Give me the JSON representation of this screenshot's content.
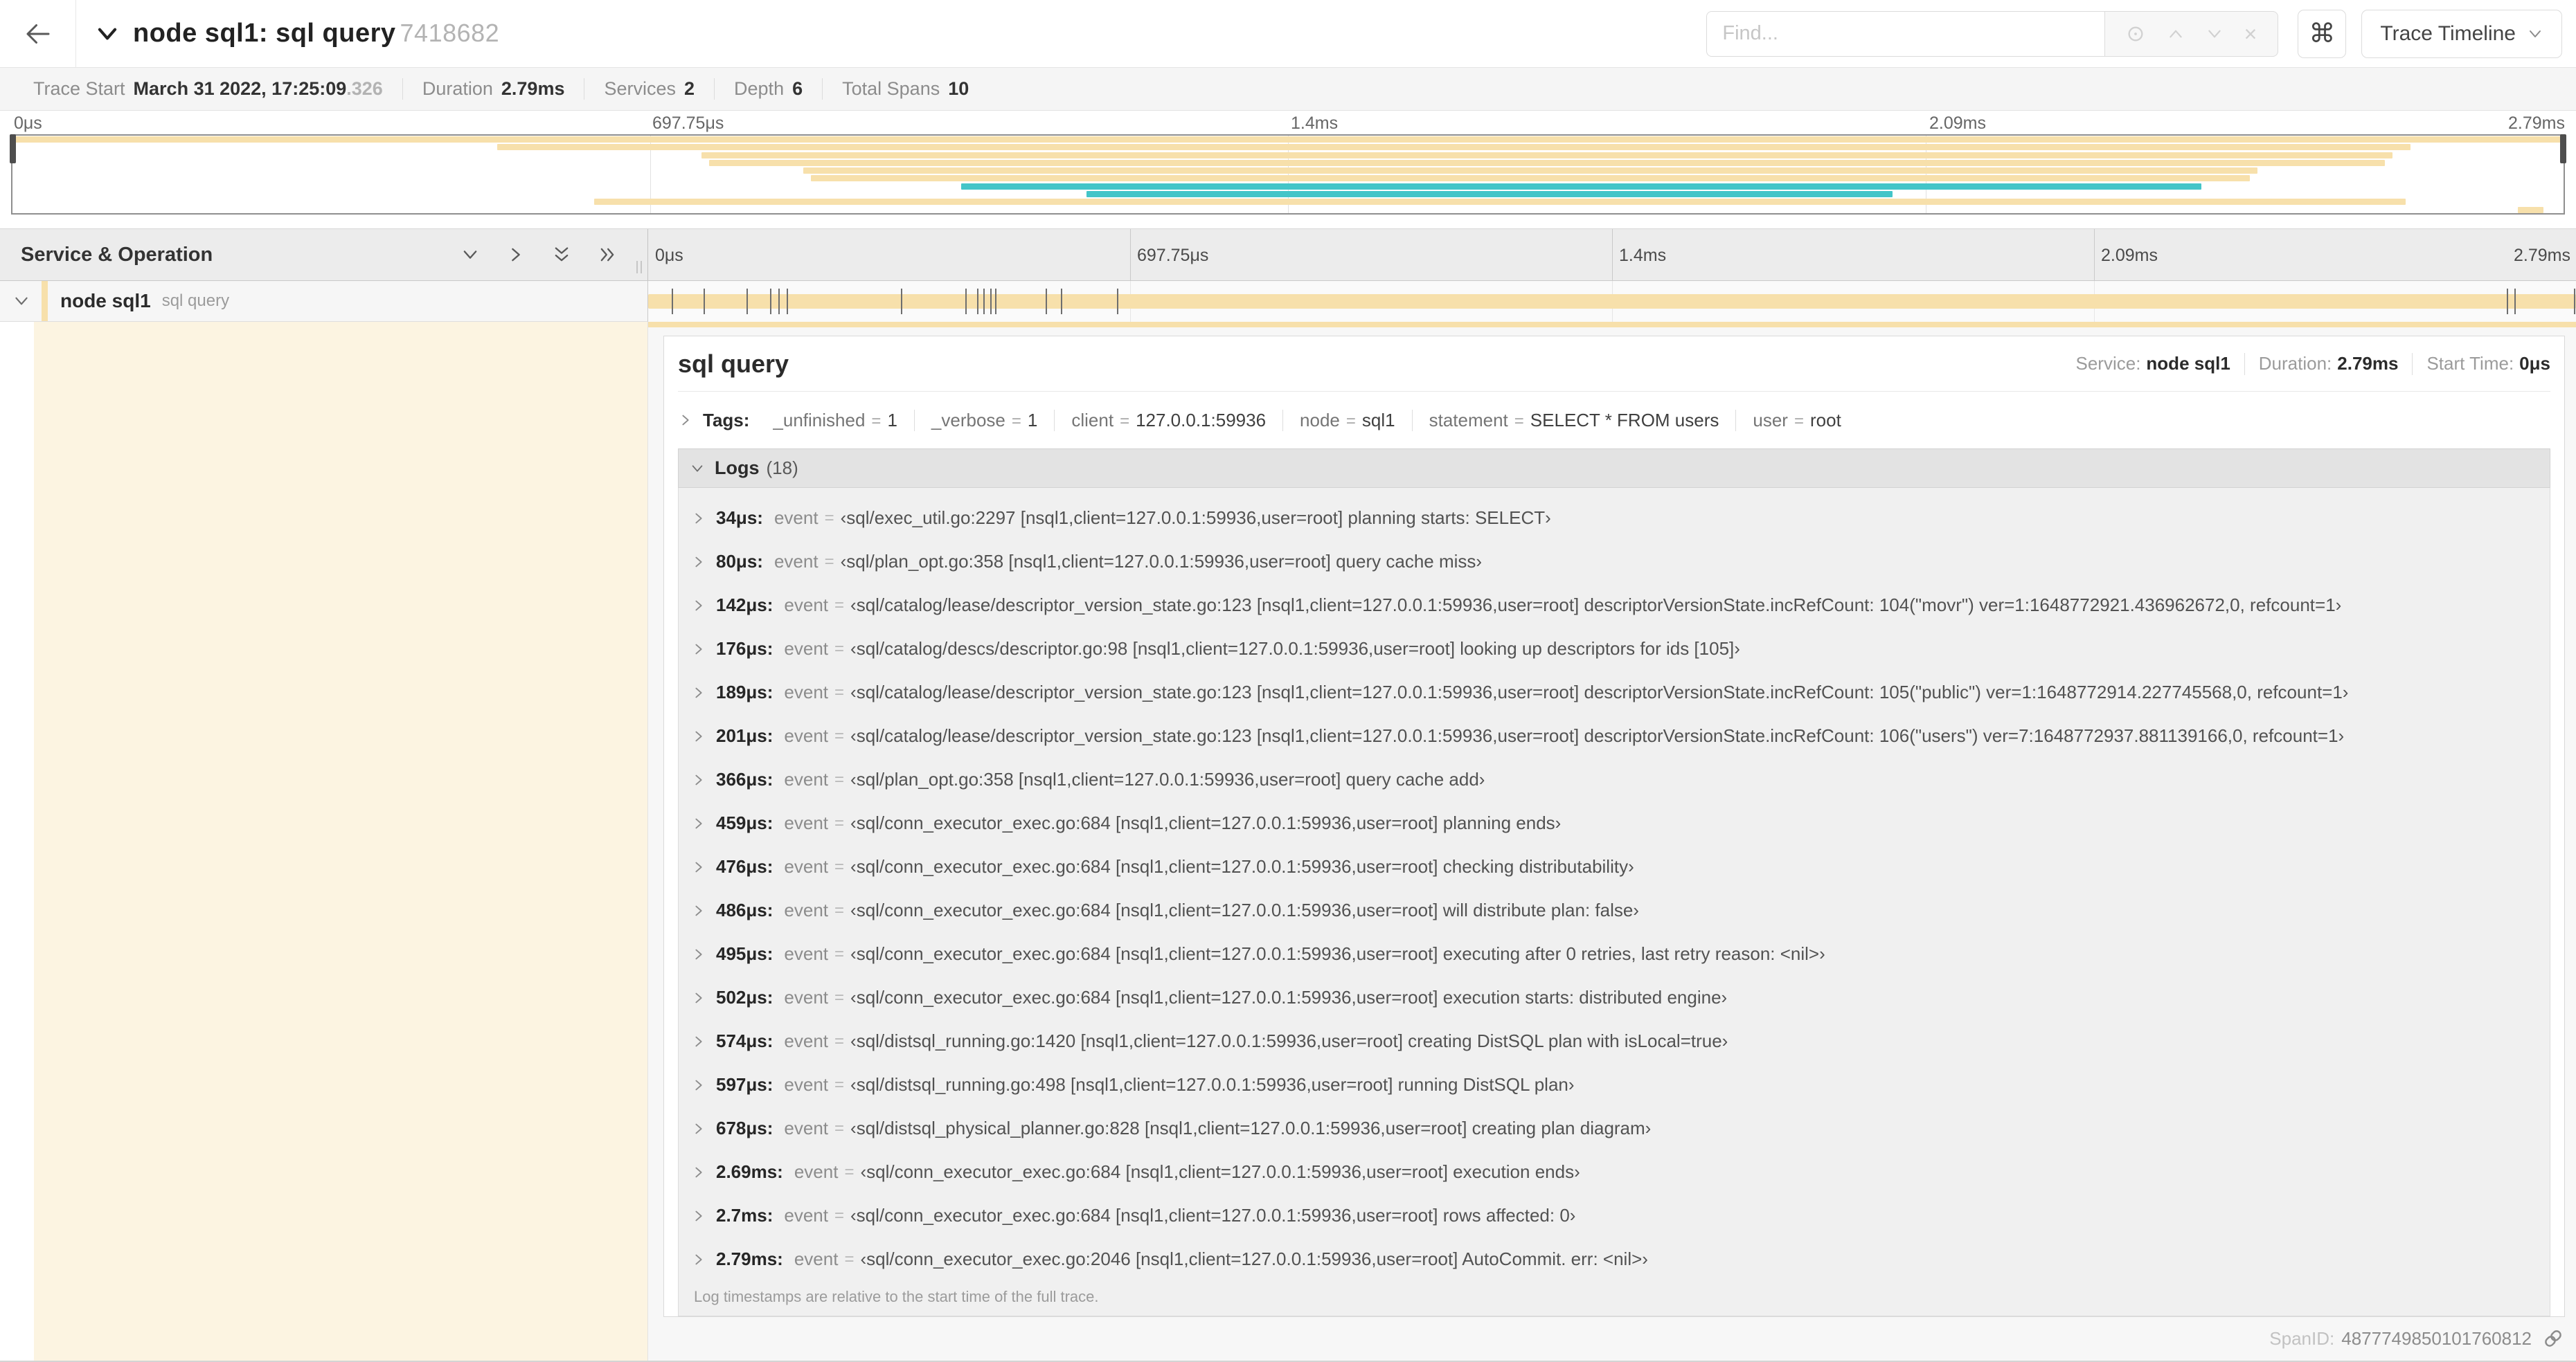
{
  "colors": {
    "tan": "#f7e0ab",
    "teal": "#43c5c8",
    "cream": "#fcf4e1"
  },
  "header": {
    "title": "node sql1: sql query",
    "trace_id_short": "7418682",
    "find_placeholder": "Find...",
    "shortcut_button": "⌘",
    "view_select": "Trace Timeline"
  },
  "stats": [
    {
      "label": "Trace Start",
      "value": "March 31 2022, 17:25:09",
      "suffix": ".326"
    },
    {
      "label": "Duration",
      "value": "2.79ms"
    },
    {
      "label": "Services",
      "value": "2"
    },
    {
      "label": "Depth",
      "value": "6"
    },
    {
      "label": "Total Spans",
      "value": "10"
    }
  ],
  "minimap": {
    "rows": [
      {
        "s": 0,
        "e": 100,
        "c": "tan"
      },
      {
        "s": 19,
        "e": 94,
        "c": "tan"
      },
      {
        "s": 27,
        "e": 93.3,
        "c": "tan"
      },
      {
        "s": 27.3,
        "e": 93,
        "c": "tan"
      },
      {
        "s": 31,
        "e": 88,
        "c": "tan"
      },
      {
        "s": 31.3,
        "e": 87.7,
        "c": "tan"
      },
      {
        "s": 37.2,
        "e": 85.8,
        "c": "teal"
      },
      {
        "s": 42.1,
        "e": 73.7,
        "c": "teal"
      },
      {
        "s": 22.8,
        "e": 93.8,
        "c": "tan"
      },
      {
        "s": 98.2,
        "e": 99.2,
        "c": "tan"
      }
    ]
  },
  "timeline": {
    "header_label": "Service & Operation",
    "ruler_ticks": [
      {
        "label": "0μs",
        "pct": 0
      },
      {
        "label": "697.75μs",
        "pct": 25
      },
      {
        "label": "1.4ms",
        "pct": 50
      },
      {
        "label": "2.09ms",
        "pct": 75
      },
      {
        "label": "2.79ms",
        "pct": 100
      }
    ],
    "span_row": {
      "service": "node sql1",
      "operation": "sql query",
      "log_marker_pcts": [
        1.22,
        2.87,
        5.09,
        6.31,
        6.77,
        7.2,
        13.1,
        16.45,
        17.05,
        17.4,
        17.75,
        18.0,
        20.6,
        21.4,
        24.3,
        96.4,
        96.8,
        99.9
      ]
    }
  },
  "detail": {
    "title": "sql query",
    "service_label": "Service:",
    "service_value": "node sql1",
    "duration_label": "Duration:",
    "duration_value": "2.79ms",
    "start_label": "Start Time:",
    "start_value": "0μs",
    "tags_label": "Tags:",
    "tags": [
      {
        "key": "_unfinished",
        "value": "1"
      },
      {
        "key": "_verbose",
        "value": "1"
      },
      {
        "key": "client",
        "value": "127.0.0.1:59936"
      },
      {
        "key": "node",
        "value": "sql1"
      },
      {
        "key": "statement",
        "value": "SELECT * FROM users"
      },
      {
        "key": "user",
        "value": "root"
      }
    ],
    "logs_label": "Logs",
    "logs_count": "(18)",
    "logs": [
      {
        "time": "34μs:",
        "key": "event",
        "value": "‹sql/exec_util.go:2297 [nsql1,client=127.0.0.1:59936,user=root] planning starts: SELECT›"
      },
      {
        "time": "80μs:",
        "key": "event",
        "value": "‹sql/plan_opt.go:358 [nsql1,client=127.0.0.1:59936,user=root] query cache miss›"
      },
      {
        "time": "142μs:",
        "key": "event",
        "value": "‹sql/catalog/lease/descriptor_version_state.go:123 [nsql1,client=127.0.0.1:59936,user=root] descriptorVersionState.incRefCount: 104(\"movr\") ver=1:1648772921.436962672,0, refcount=1›"
      },
      {
        "time": "176μs:",
        "key": "event",
        "value": "‹sql/catalog/descs/descriptor.go:98 [nsql1,client=127.0.0.1:59936,user=root] looking up descriptors for ids [105]›"
      },
      {
        "time": "189μs:",
        "key": "event",
        "value": "‹sql/catalog/lease/descriptor_version_state.go:123 [nsql1,client=127.0.0.1:59936,user=root] descriptorVersionState.incRefCount: 105(\"public\") ver=1:1648772914.227745568,0, refcount=1›"
      },
      {
        "time": "201μs:",
        "key": "event",
        "value": "‹sql/catalog/lease/descriptor_version_state.go:123 [nsql1,client=127.0.0.1:59936,user=root] descriptorVersionState.incRefCount: 106(\"users\") ver=7:1648772937.881139166,0, refcount=1›"
      },
      {
        "time": "366μs:",
        "key": "event",
        "value": "‹sql/plan_opt.go:358 [nsql1,client=127.0.0.1:59936,user=root] query cache add›"
      },
      {
        "time": "459μs:",
        "key": "event",
        "value": "‹sql/conn_executor_exec.go:684 [nsql1,client=127.0.0.1:59936,user=root] planning ends›"
      },
      {
        "time": "476μs:",
        "key": "event",
        "value": "‹sql/conn_executor_exec.go:684 [nsql1,client=127.0.0.1:59936,user=root] checking distributability›"
      },
      {
        "time": "486μs:",
        "key": "event",
        "value": "‹sql/conn_executor_exec.go:684 [nsql1,client=127.0.0.1:59936,user=root] will distribute plan: false›"
      },
      {
        "time": "495μs:",
        "key": "event",
        "value": "‹sql/conn_executor_exec.go:684 [nsql1,client=127.0.0.1:59936,user=root] executing after 0 retries, last retry reason: <nil>›"
      },
      {
        "time": "502μs:",
        "key": "event",
        "value": "‹sql/conn_executor_exec.go:684 [nsql1,client=127.0.0.1:59936,user=root] execution starts: distributed engine›"
      },
      {
        "time": "574μs:",
        "key": "event",
        "value": "‹sql/distsql_running.go:1420 [nsql1,client=127.0.0.1:59936,user=root] creating DistSQL plan with isLocal=true›"
      },
      {
        "time": "597μs:",
        "key": "event",
        "value": "‹sql/distsql_running.go:498 [nsql1,client=127.0.0.1:59936,user=root] running DistSQL plan›"
      },
      {
        "time": "678μs:",
        "key": "event",
        "value": "‹sql/distsql_physical_planner.go:828 [nsql1,client=127.0.0.1:59936,user=root] creating plan diagram›"
      },
      {
        "time": "2.69ms:",
        "key": "event",
        "value": "‹sql/conn_executor_exec.go:684 [nsql1,client=127.0.0.1:59936,user=root] execution ends›"
      },
      {
        "time": "2.7ms:",
        "key": "event",
        "value": "‹sql/conn_executor_exec.go:684 [nsql1,client=127.0.0.1:59936,user=root] rows affected: 0›"
      },
      {
        "time": "2.79ms:",
        "key": "event",
        "value": "‹sql/conn_executor_exec.go:2046 [nsql1,client=127.0.0.1:59936,user=root] AutoCommit. err: <nil>›"
      }
    ],
    "logs_note": "Log timestamps are relative to the start time of the full trace.",
    "spanid_label": "SpanID:",
    "spanid_value": "4877749850101760812"
  }
}
